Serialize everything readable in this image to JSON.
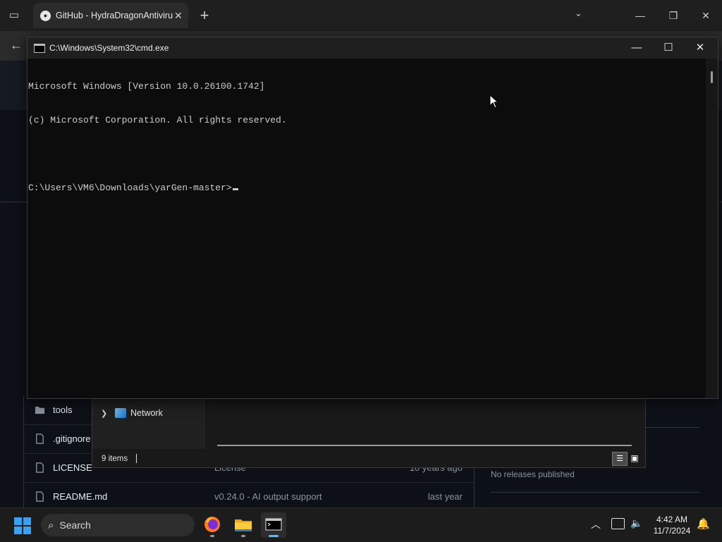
{
  "browser": {
    "tab_title": "GitHub - HydraDragonAntivirus",
    "new_tab_label": "+",
    "controls": {
      "tab_list": "⌄",
      "minimize": "—",
      "restore": "❐",
      "close": "✕"
    },
    "back_label": "←"
  },
  "github": {
    "files": [
      {
        "name": "tools",
        "message": "",
        "date": "",
        "type": "folder"
      },
      {
        "name": ".gitignore",
        "message": "",
        "date": "",
        "type": "file"
      },
      {
        "name": "LICENSE",
        "message": "License",
        "date": "10 years ago",
        "type": "file"
      },
      {
        "name": "README.md",
        "message": "v0.24.0 - AI output support",
        "date": "last year",
        "type": "file"
      }
    ],
    "releases_text": "No releases published"
  },
  "explorer": {
    "nav_item": "Network",
    "status_text": "9 items"
  },
  "cmd": {
    "title": "C:\\Windows\\System32\\cmd.exe",
    "lines": [
      "Microsoft Windows [Version 10.0.26100.1742]",
      "(c) Microsoft Corporation. All rights reserved.",
      "",
      "C:\\Users\\VM6\\Downloads\\yarGen-master>"
    ],
    "controls": {
      "minimize": "—",
      "maximize": "☐",
      "close": "✕"
    }
  },
  "taskbar": {
    "search_placeholder": "Search",
    "apps": [
      "firefox-icon",
      "file-explorer-icon",
      "terminal-icon"
    ],
    "time": "4:42 AM",
    "date": "11/7/2024"
  },
  "colors": {
    "accent": "#3aa0f3",
    "cmd_bg": "#0c0c0c",
    "github_bg": "#0d1117"
  }
}
